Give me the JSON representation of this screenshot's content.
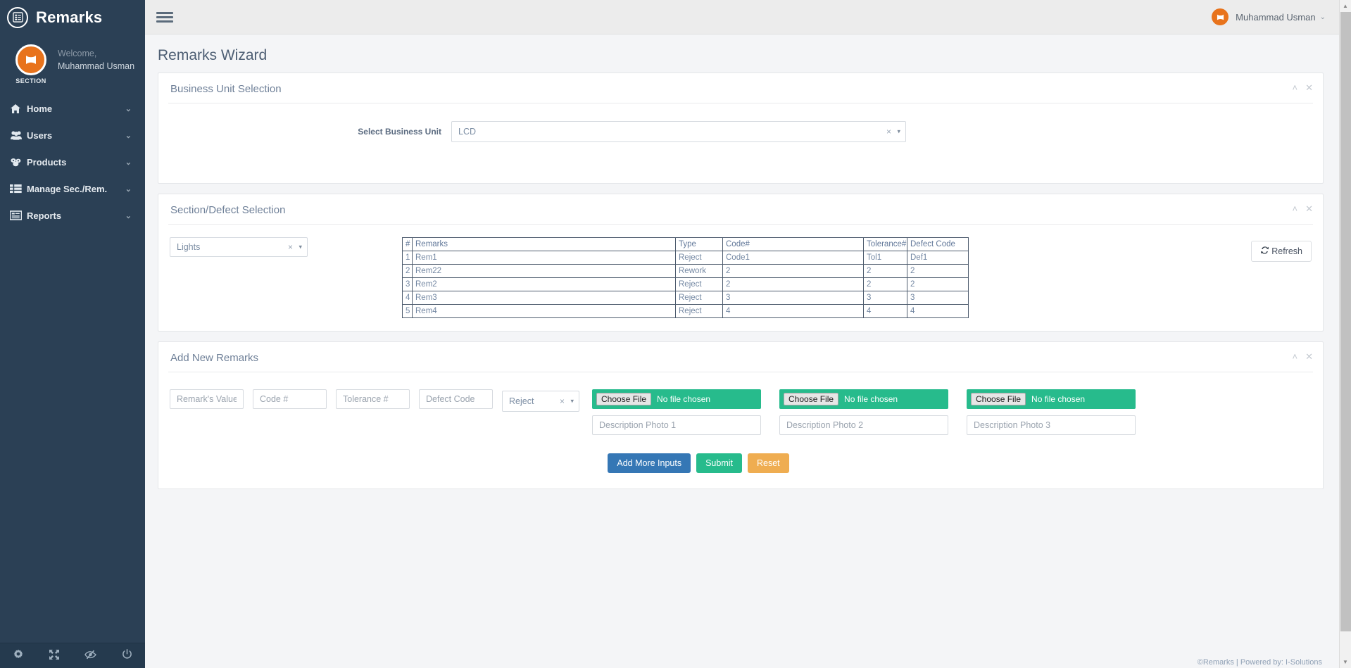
{
  "brand": {
    "title": "Remarks",
    "logo_icon": "list-alt-icon",
    "logo_glyph": "☰"
  },
  "sidebar": {
    "profile": {
      "welcome": "Welcome,",
      "user_name": "Muhammad Usman",
      "avatar_caption": "SECTION",
      "avatar_glyph": "✖"
    },
    "items": [
      {
        "label": "Home",
        "icon": "home-icon",
        "glyph": "⌂",
        "caret": "⌄"
      },
      {
        "label": "Users",
        "icon": "users-icon",
        "glyph": "⛭",
        "caret": "⌄"
      },
      {
        "label": "Products",
        "icon": "cubes-icon",
        "glyph": "☸",
        "caret": "⌄"
      },
      {
        "label": "Manage Sec./Rem.",
        "icon": "th-list-icon",
        "glyph": "☷",
        "caret": "⌄"
      },
      {
        "label": "Reports",
        "icon": "book-icon",
        "glyph": "▤",
        "caret": "⌄"
      }
    ],
    "footer_icons": [
      {
        "name": "settings-gear-icon",
        "glyph": "⚙"
      },
      {
        "name": "fullscreen-icon",
        "glyph": "⛶"
      },
      {
        "name": "eye-slash-icon",
        "glyph": "⌾"
      },
      {
        "name": "power-off-icon",
        "glyph": "⏻"
      }
    ]
  },
  "topbar": {
    "menu_toggle_icon": "hamburger-icon",
    "user_name": "Muhammad Usman",
    "user_avatar_glyph": "✖",
    "user_caret": "⌄"
  },
  "page": {
    "title": "Remarks Wizard"
  },
  "panel_tools": {
    "collapse_glyph": "˄",
    "close_glyph": "✕"
  },
  "business_unit_panel": {
    "title": "Business Unit Selection",
    "field_label": "Select Business Unit",
    "select_value": "LCD",
    "clear_glyph": "×",
    "caret_glyph": "▾"
  },
  "section_defect_panel": {
    "title": "Section/Defect Selection",
    "section_select_value": "Lights",
    "clear_glyph": "×",
    "caret_glyph": "▾",
    "refresh_button": {
      "label": "Refresh",
      "icon": "refresh-icon",
      "glyph": "↻"
    },
    "table": {
      "columns": [
        "#",
        "Remarks",
        "Type",
        "Code#",
        "Tolerance#",
        "Defect Code"
      ],
      "rows": [
        {
          "idx": "1",
          "remarks": "Rem1",
          "type": "Reject",
          "code": "Code1",
          "tolerance": "Tol1",
          "defect": "Def1"
        },
        {
          "idx": "2",
          "remarks": "Rem22",
          "type": "Rework",
          "code": "2",
          "tolerance": "2",
          "defect": "2"
        },
        {
          "idx": "3",
          "remarks": "Rem2",
          "type": "Reject",
          "code": "2",
          "tolerance": "2",
          "defect": "2"
        },
        {
          "idx": "4",
          "remarks": "Rem3",
          "type": "Reject",
          "code": "3",
          "tolerance": "3",
          "defect": "3"
        },
        {
          "idx": "5",
          "remarks": "Rem4",
          "type": "Reject",
          "code": "4",
          "tolerance": "4",
          "defect": "4"
        }
      ]
    }
  },
  "add_new_remarks_panel": {
    "title": "Add New Remarks",
    "fields": {
      "remark_value_placeholder": "Remark's Value/Name",
      "code_placeholder": "Code #",
      "tolerance_placeholder": "Tolerance #",
      "defect_code_placeholder": "Defect Code",
      "type_select_value": "Reject",
      "clear_glyph": "×",
      "caret_glyph": "▾"
    },
    "file_uploads": [
      {
        "button_label": "Choose File",
        "status": "No file chosen",
        "desc_placeholder": "Description Photo 1"
      },
      {
        "button_label": "Choose File",
        "status": "No file chosen",
        "desc_placeholder": "Description Photo 2"
      },
      {
        "button_label": "Choose File",
        "status": "No file chosen",
        "desc_placeholder": "Description Photo 3"
      }
    ],
    "actions": {
      "add_more": "Add More Inputs",
      "submit": "Submit",
      "reset": "Reset"
    }
  },
  "footer": {
    "text": "©Remarks | Powered by: I-Solutions"
  },
  "colors": {
    "sidebar_bg": "#2b4055",
    "topbar_bg": "#ececec",
    "body_bg": "#f4f5f7",
    "accent_orange": "#e8731c",
    "primary_blue": "#3577b5",
    "success_green": "#27bb8c",
    "warning_orange": "#efad51",
    "panel_title": "#6f8098"
  },
  "scrollbar": {
    "up_glyph": "▲",
    "down_glyph": "▼"
  }
}
